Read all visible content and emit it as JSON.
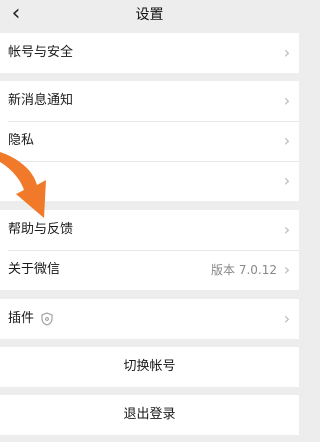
{
  "nav": {
    "back_icon": "chevron-left-icon",
    "back_glyph": "‹",
    "title": "设置"
  },
  "groups": [
    {
      "items": [
        {
          "label": "帐号与安全",
          "value": "",
          "chevron": "›"
        }
      ]
    },
    {
      "items": [
        {
          "label": "新消息通知",
          "value": "",
          "chevron": "›"
        },
        {
          "label": "隐私",
          "value": "",
          "chevron": "›"
        },
        {
          "label": "",
          "value": "",
          "chevron": "›"
        }
      ]
    },
    {
      "items": [
        {
          "label": "帮助与反馈",
          "value": "",
          "chevron": "›"
        },
        {
          "label": "关于微信",
          "value": "版本 7.0.12",
          "chevron": "›"
        }
      ]
    },
    {
      "items": [
        {
          "label": "插件",
          "value": "",
          "chevron": "›",
          "icon": "shield-icon"
        }
      ]
    }
  ],
  "actions": {
    "switch_account": "切换帐号",
    "logout": "退出登录"
  },
  "overlay": {
    "arrow_icon": "orange-arrow-icon",
    "arrow_color": "#f07a2a"
  },
  "colors": {
    "background": "#ededed",
    "card": "#ffffff",
    "chevron": "#b7b7b7",
    "value_text": "#888888"
  }
}
